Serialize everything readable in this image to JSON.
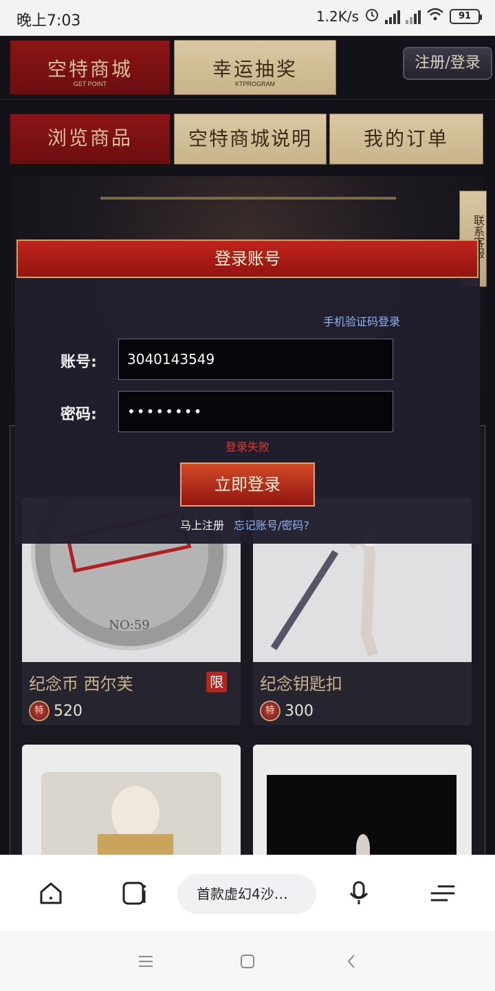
{
  "status_bar": {
    "time": "晚上7:03",
    "network_speed": "1.2K/s",
    "battery": "91",
    "icons": [
      "alarm-icon",
      "hd-signal-icon",
      "signal-icon",
      "wifi-icon",
      "battery-icon"
    ]
  },
  "top_nav": {
    "shop": {
      "label": "空特商城",
      "sub": "GET POINT"
    },
    "lottery": {
      "label": "幸运抽奖",
      "sub": "KTPROGRAM"
    },
    "register_login": "注册/登录"
  },
  "sub_nav": {
    "browse": "浏览商品",
    "about": "空特商城说明",
    "orders": "我的订单"
  },
  "side_tab": "联系客服",
  "login_modal": {
    "title": "登录账号",
    "sms_login": "手机验证码登录",
    "account_label": "账号:",
    "account_value": "3040143549",
    "password_label": "密码:",
    "password_value": "••••••••",
    "error": "登录失败",
    "submit": "立即登录",
    "register": "马上注册",
    "forgot": "忘记账号/密码?"
  },
  "products": [
    {
      "name": "纪念币 西尔芙",
      "price": "520",
      "limited": "限",
      "coin": "特"
    },
    {
      "name": "纪念钥匙扣",
      "price": "300",
      "coin": "特"
    }
  ],
  "browser": {
    "url_text": "首款虚幻4沙…",
    "icons": [
      "home-icon",
      "tabs-icon",
      "mic-icon",
      "menu-icon"
    ]
  },
  "system_nav": {
    "icons": [
      "recent-apps-icon",
      "home-square-icon",
      "back-icon"
    ]
  }
}
